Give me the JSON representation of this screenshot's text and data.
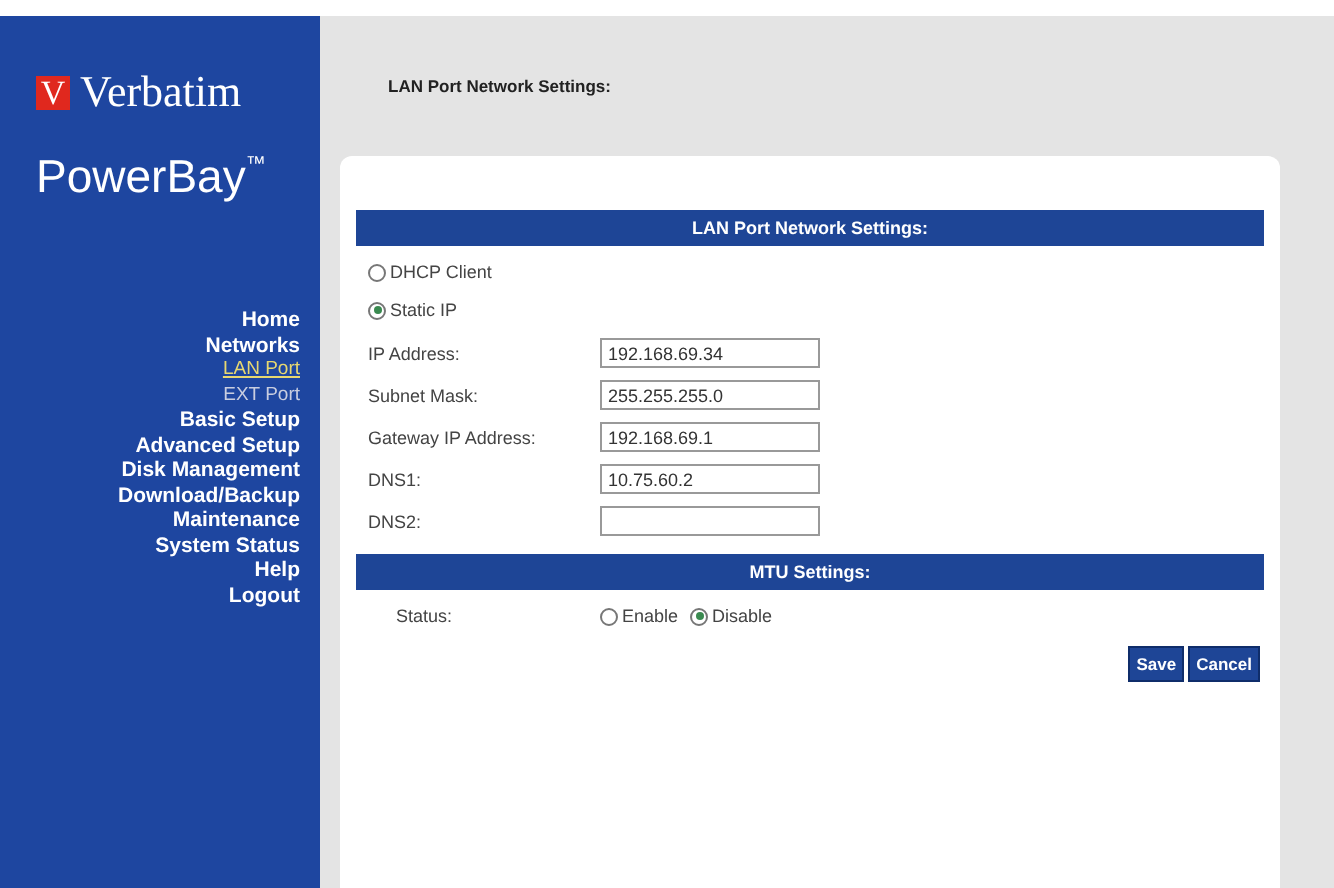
{
  "sidebar": {
    "brand": "Verbatim",
    "logo_mark": "V",
    "product": "PowerBay",
    "trademark": "™",
    "items": [
      {
        "label": "Home",
        "kind": "main",
        "selected": false
      },
      {
        "label": "Networks",
        "kind": "main",
        "selected": false
      },
      {
        "label": "LAN Port",
        "kind": "sub",
        "selected": true
      },
      {
        "label": "EXT Port",
        "kind": "sub",
        "selected": false
      },
      {
        "label": "Basic Setup",
        "kind": "main",
        "selected": false
      },
      {
        "label": "Advanced Setup",
        "kind": "main",
        "selected": false
      },
      {
        "label": "Disk Management",
        "kind": "main",
        "selected": false
      },
      {
        "label": "Download/Backup",
        "kind": "main",
        "selected": false
      },
      {
        "label": "Maintenance",
        "kind": "main",
        "selected": false
      },
      {
        "label": "System Status",
        "kind": "main",
        "selected": false
      },
      {
        "label": "Help",
        "kind": "main",
        "selected": false
      },
      {
        "label": "Logout",
        "kind": "main",
        "selected": false
      }
    ]
  },
  "page_title": "LAN Port Network Settings:",
  "lan_section": {
    "title": "LAN Port Network Settings:",
    "modes": [
      {
        "label": "DHCP Client",
        "selected": false
      },
      {
        "label": "Static IP",
        "selected": true
      }
    ],
    "fields": [
      {
        "label": "IP Address:",
        "value": "192.168.69.34"
      },
      {
        "label": "Subnet Mask:",
        "value": "255.255.255.0"
      },
      {
        "label": "Gateway IP Address:",
        "value": "192.168.69.1"
      },
      {
        "label": "DNS1:",
        "value": "10.75.60.2"
      },
      {
        "label": "DNS2:"
      }
    ]
  },
  "mtu_section": {
    "title": "MTU Settings:",
    "status_label": "Status:",
    "options": [
      {
        "label": "Enable",
        "selected": false
      },
      {
        "label": "Disable",
        "selected": true
      }
    ]
  },
  "buttons": [
    "Save",
    "Cancel"
  ]
}
